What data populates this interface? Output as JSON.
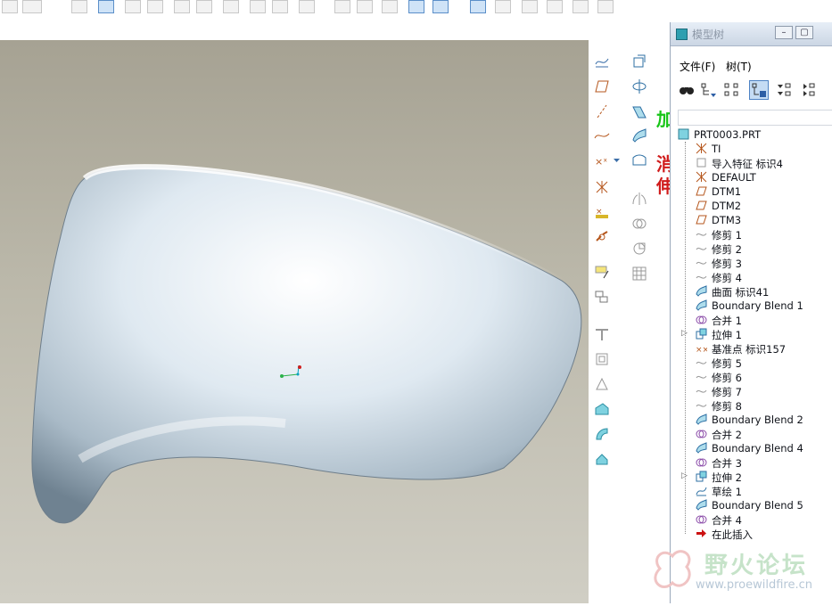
{
  "model_tree": {
    "title": "模型树",
    "window_buttons": {
      "minimize": "–",
      "restore": "▢"
    },
    "menu": [
      "文件(F)",
      "树(T)"
    ],
    "items": [
      {
        "label": "PRT0003.PRT",
        "icon": "part-icon"
      },
      {
        "label": "TI",
        "icon": "coordinate-system-icon"
      },
      {
        "label": "导入特征 标识4",
        "icon": "import-feature-icon"
      },
      {
        "label": "DEFAULT",
        "icon": "coordinate-system-icon"
      },
      {
        "label": "DTM1",
        "icon": "datum-plane-icon"
      },
      {
        "label": "DTM2",
        "icon": "datum-plane-icon"
      },
      {
        "label": "DTM3",
        "icon": "datum-plane-icon"
      },
      {
        "label": "修剪 1",
        "icon": "trim-icon"
      },
      {
        "label": "修剪 2",
        "icon": "trim-icon"
      },
      {
        "label": "修剪 3",
        "icon": "trim-icon"
      },
      {
        "label": "修剪 4",
        "icon": "trim-icon"
      },
      {
        "label": "曲面 标识41",
        "icon": "surface-icon"
      },
      {
        "label": "Boundary Blend 1",
        "icon": "boundary-blend-icon"
      },
      {
        "label": "合并 1",
        "icon": "merge-icon"
      },
      {
        "label": "拉伸 1",
        "icon": "extrude-icon"
      },
      {
        "label": "基准点 标识157",
        "icon": "datum-point-icon"
      },
      {
        "label": "修剪 5",
        "icon": "trim-icon"
      },
      {
        "label": "修剪 6",
        "icon": "trim-icon"
      },
      {
        "label": "修剪 7",
        "icon": "trim-icon"
      },
      {
        "label": "修剪 8",
        "icon": "trim-icon"
      },
      {
        "label": "Boundary Blend 2",
        "icon": "boundary-blend-icon"
      },
      {
        "label": "合并 2",
        "icon": "merge-icon"
      },
      {
        "label": "Boundary Blend 4",
        "icon": "boundary-blend-icon"
      },
      {
        "label": "合并 3",
        "icon": "merge-icon"
      },
      {
        "label": "拉伸 2",
        "icon": "extrude-icon"
      },
      {
        "label": "草绘 1",
        "icon": "sketch-icon"
      },
      {
        "label": "Boundary Blend 5",
        "icon": "boundary-blend-icon"
      },
      {
        "label": "合并 4",
        "icon": "merge-icon"
      },
      {
        "label": "在此插入",
        "icon": "insert-here-arrow-icon"
      }
    ]
  },
  "peek_text": [
    "加",
    "消",
    "伸"
  ],
  "watermark": {
    "name": "野火论坛",
    "url": "www.proewildfire.cn"
  },
  "colors": {
    "accent": "#4e83c4",
    "viewport_bg": "#b4b1a2",
    "surface": "#dbe6ef",
    "insert_arrow": "#cc1111"
  }
}
